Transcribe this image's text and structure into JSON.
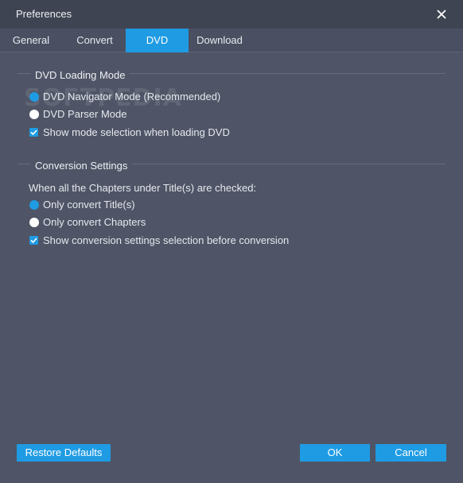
{
  "window": {
    "title": "Preferences"
  },
  "tabs": [
    {
      "label": "General",
      "active": false
    },
    {
      "label": "Convert",
      "active": false
    },
    {
      "label": "DVD",
      "active": true
    },
    {
      "label": "Download",
      "active": false
    }
  ],
  "dvd_loading": {
    "title": "DVD Loading Mode",
    "navigator_mode": {
      "label": "DVD Navigator Mode (Recommended)",
      "selected": true
    },
    "parser_mode": {
      "label": "DVD Parser Mode",
      "selected": false
    },
    "show_mode_selection": {
      "label": "Show mode selection when loading DVD",
      "checked": true
    }
  },
  "conversion": {
    "title": "Conversion Settings",
    "prompt": "When all the Chapters under Title(s) are checked:",
    "only_titles": {
      "label": "Only convert Title(s)",
      "selected": true
    },
    "only_chapters": {
      "label": "Only convert Chapters",
      "selected": false
    },
    "show_settings": {
      "label": "Show conversion settings selection before conversion",
      "checked": true
    }
  },
  "watermark": "SOFTPEDIA",
  "footer": {
    "restore_label": "Restore Defaults",
    "ok_label": "OK",
    "cancel_label": "Cancel"
  },
  "colors": {
    "accent": "#1f9be3",
    "background": "#4f5566",
    "titlebar": "#3f4452"
  }
}
